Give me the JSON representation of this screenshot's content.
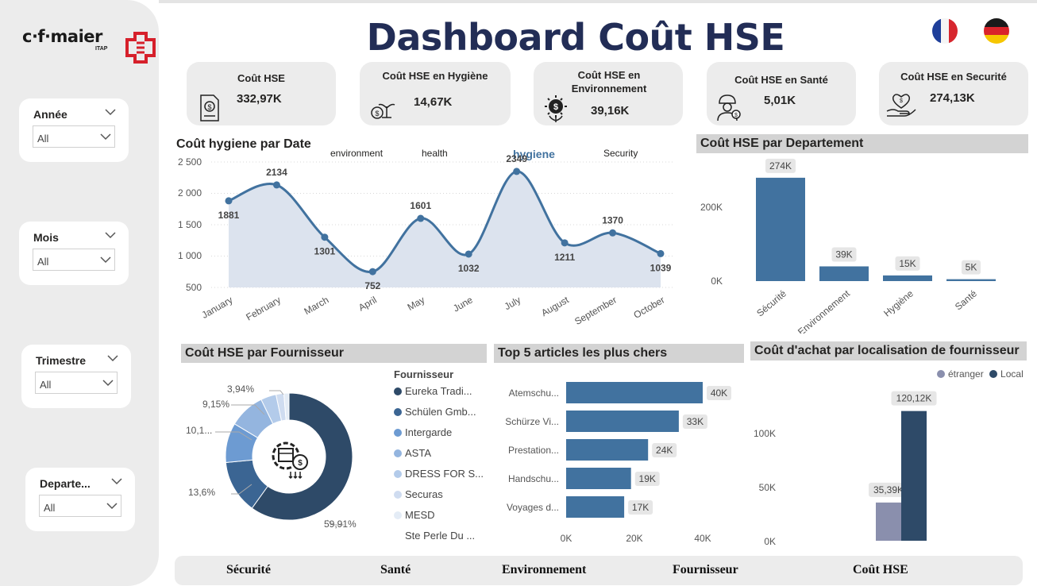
{
  "title": "Dashboard Coût HSE",
  "logo": {
    "text": "c·f·maier",
    "sub": "ITAP"
  },
  "slicers": [
    {
      "title": "Année",
      "value": "All"
    },
    {
      "title": "Mois",
      "value": "All"
    },
    {
      "title": "Trimestre",
      "value": "All"
    },
    {
      "title": "Departe...",
      "value": "All"
    }
  ],
  "kpis": [
    {
      "title": "Coût HSE",
      "value": "332,97K",
      "icon": "document-coin-icon"
    },
    {
      "title": "Coût HSE en Hygiène",
      "value": "14,67K",
      "icon": "money-plant-icon"
    },
    {
      "title": "Coût HSE en Environnement",
      "value": "39,16K",
      "icon": "coin-leaf-icon"
    },
    {
      "title": "Coût HSE en Santé",
      "value": "5,01K",
      "icon": "worker-icon"
    },
    {
      "title": "Coût HSE en Securité",
      "value": "274,13K",
      "icon": "heart-hand-icon"
    }
  ],
  "line_chart": {
    "title": "Coût hygiene par Date",
    "tabs": [
      "environment",
      "health",
      "hygiene",
      "Security"
    ],
    "active_tab": "hygiene",
    "y_ticks": [
      "2 500",
      "2 000",
      "1 500",
      "1 000",
      "500"
    ],
    "color": "#41729f",
    "fill": "#dce3ee"
  },
  "dept_chart": {
    "title": "Coût HSE par Departement",
    "y_ticks": [
      "200K",
      "0K"
    ],
    "color": "#41729f"
  },
  "donut_chart": {
    "title": "Coût HSE par Fournisseur",
    "legend_title": "Fournisseur",
    "labels": [
      "59,91%",
      "13,6%",
      "10,1...",
      "9,15%",
      "3,94%"
    ],
    "icon": "gear-box-coin-icon"
  },
  "top5_chart": {
    "title": "Top 5 articles les plus chers",
    "x_ticks": [
      "0K",
      "20K",
      "40K"
    ],
    "color": "#41729f"
  },
  "loc_chart": {
    "title": "Coût d'achat par localisation de fournisseur",
    "y_ticks": [
      "100K",
      "50K",
      "0K"
    ],
    "legend": [
      {
        "name": "étranger",
        "color": "#8a8fad"
      },
      {
        "name": "Local",
        "color": "#2e4a68"
      }
    ]
  },
  "chart_data": [
    {
      "type": "line",
      "title": "Coût hygiene par Date",
      "x": [
        "January",
        "February",
        "March",
        "April",
        "May",
        "June",
        "July",
        "August",
        "September",
        "October"
      ],
      "values": [
        1881,
        2134,
        1301,
        752,
        1601,
        1032,
        2349,
        1211,
        1370,
        1039
      ],
      "ylim": [
        500,
        2500
      ],
      "grid": true
    },
    {
      "type": "bar",
      "title": "Coût HSE par Departement",
      "categories": [
        "Sécurité",
        "Environnement",
        "Hygiène",
        "Santé"
      ],
      "values": [
        274,
        39,
        15,
        5
      ],
      "labels": [
        "274K",
        "39K",
        "15K",
        "5K"
      ],
      "ylim": [
        0,
        280
      ]
    },
    {
      "type": "pie",
      "title": "Coût HSE par Fournisseur",
      "categories": [
        "Eureka Tradi...",
        "Schülen Gmb...",
        "Intergarde",
        "ASTA",
        "DRESS FOR S...",
        "Securas",
        "MESD",
        "Ste Perle Du ..."
      ],
      "values": [
        59.91,
        13.6,
        10.1,
        9.15,
        3.94,
        2.0,
        1.3,
        0.0
      ],
      "colors": [
        "#2e4a68",
        "#3b6593",
        "#6d9bd2",
        "#94b5df",
        "#b3cbea",
        "#cfdcf0",
        "#e4ecf6",
        "#f2f5fa"
      ]
    },
    {
      "type": "bar",
      "orientation": "horizontal",
      "title": "Top 5 articles les plus chers",
      "categories": [
        "Atemschu...",
        "Schürze Vi...",
        "Prestation...",
        "Handschu...",
        "Voyages d..."
      ],
      "values": [
        40,
        33,
        24,
        19,
        17
      ],
      "labels": [
        "40K",
        "33K",
        "24K",
        "19K",
        "17K"
      ],
      "xlim": [
        0,
        40
      ]
    },
    {
      "type": "bar",
      "title": "Coût d'achat par localisation de fournisseur",
      "series": [
        {
          "name": "étranger",
          "values": [
            35.39
          ]
        },
        {
          "name": "Local",
          "values": [
            120.12
          ]
        }
      ],
      "labels": [
        "35,39K",
        "120,12K"
      ],
      "ylim": [
        0,
        120
      ]
    }
  ],
  "footer_nav": [
    "Sécurité",
    "Santé",
    "Environnement",
    "Fournisseur",
    "Coût HSE"
  ]
}
